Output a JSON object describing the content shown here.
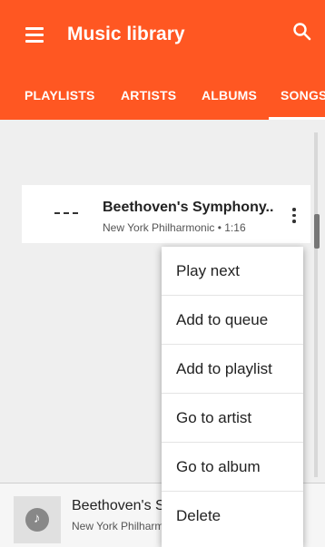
{
  "appbar": {
    "title": "Music library",
    "menu_icon": "hamburger-menu-icon",
    "search_icon": "search-icon",
    "color": "#ff5722"
  },
  "tabs": [
    {
      "label": "PLAYLISTS"
    },
    {
      "label": "ARTISTS"
    },
    {
      "label": "ALBUMS"
    },
    {
      "label": "SONGS",
      "selected": true
    }
  ],
  "song": {
    "title": "Beethoven's Symphony..",
    "subtitle": "New York Philharmonic • 1:16",
    "art_placeholder": "---"
  },
  "context_menu": {
    "items": [
      {
        "label": "Play next"
      },
      {
        "label": "Add to queue"
      },
      {
        "label": "Add to playlist"
      },
      {
        "label": "Go to artist"
      },
      {
        "label": "Go to album"
      },
      {
        "label": "Delete"
      }
    ]
  },
  "now_playing": {
    "title": "Beethoven's S",
    "subtitle": "New York Philharm",
    "icon": "music-note-icon"
  }
}
